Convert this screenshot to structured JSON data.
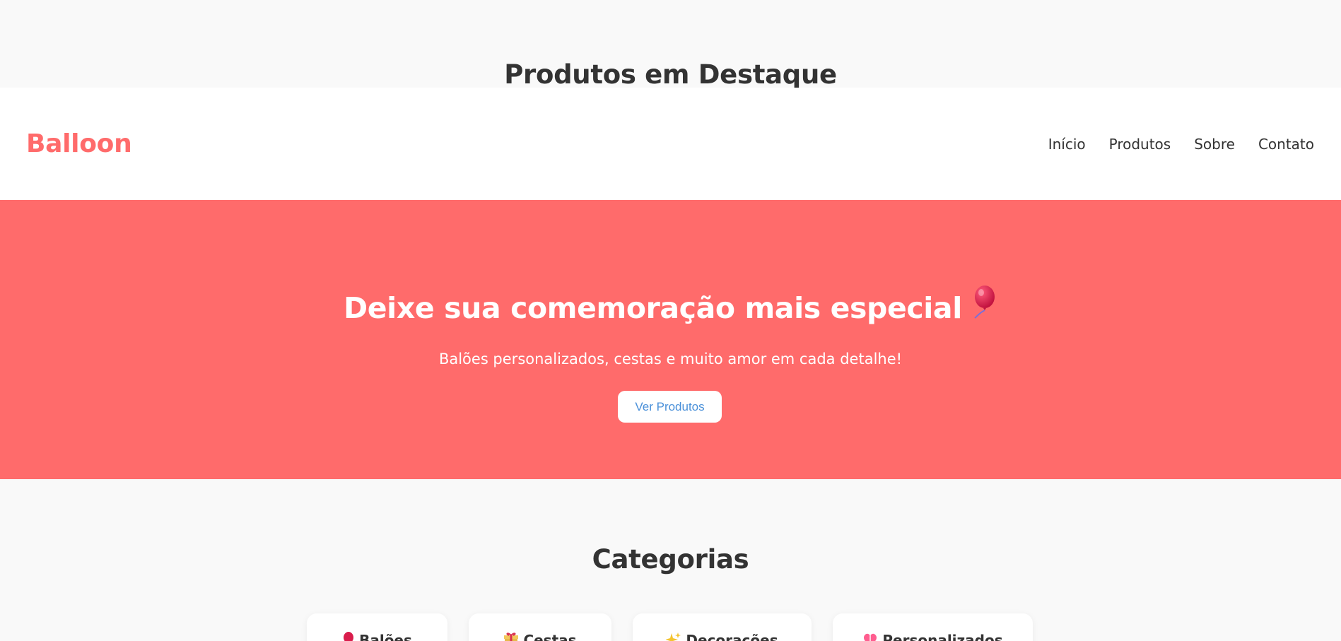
{
  "featured": {
    "title": "Produtos em Destaque"
  },
  "header": {
    "logo": "Balloon",
    "nav": [
      {
        "label": "Início"
      },
      {
        "label": "Produtos"
      },
      {
        "label": "Sobre"
      },
      {
        "label": "Contato"
      }
    ]
  },
  "hero": {
    "title": "Deixe sua comemoração mais especial",
    "title_icon": "balloon-icon",
    "subtitle": "Balões personalizados, cestas e muito amor em cada detalhe!",
    "button_label": "Ver Produtos"
  },
  "categories": {
    "title": "Categorias",
    "items": [
      {
        "label": "Balões",
        "icon": "balloon-icon"
      },
      {
        "label": "Cestas",
        "icon": "gift-icon"
      },
      {
        "label": "Decorações",
        "icon": "sparkles-icon"
      },
      {
        "label": "Personalizados",
        "icon": "heart-gift-icon"
      }
    ]
  },
  "colors": {
    "brand": "#ff6b6b",
    "background": "#f9f9f9",
    "text": "#333333",
    "button_text": "#4a90d9",
    "white": "#ffffff"
  }
}
